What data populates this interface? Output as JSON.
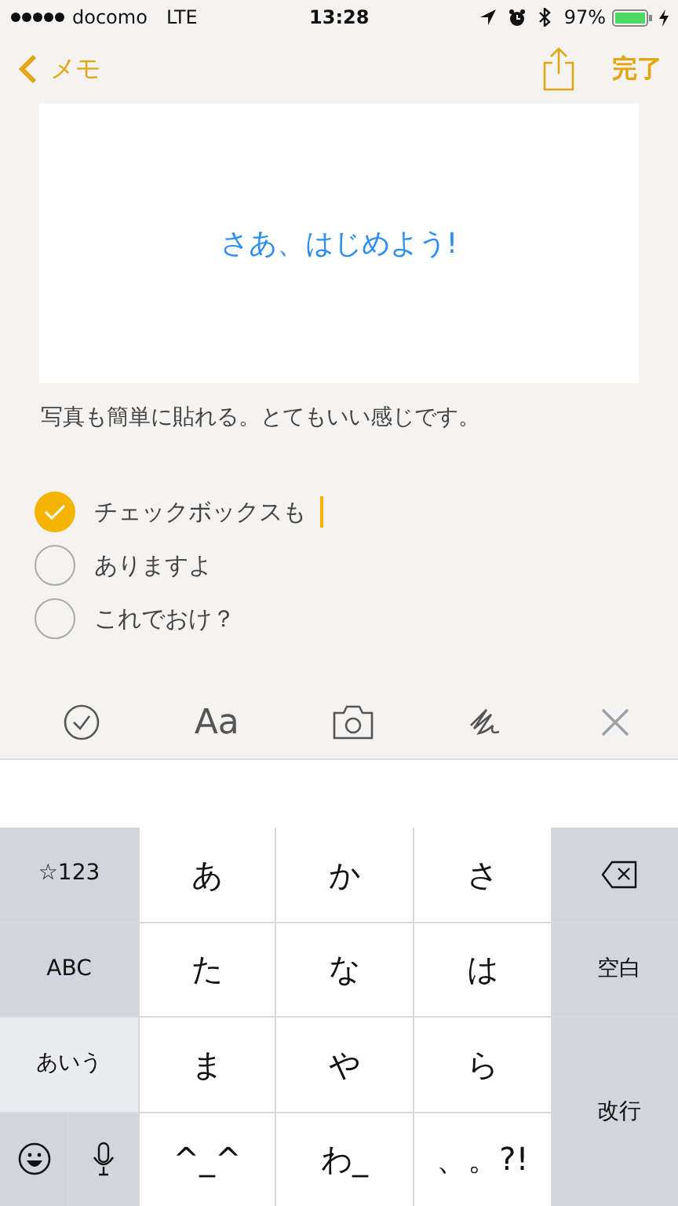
{
  "status_bar": {
    "carrier": "docomo",
    "network": "LTE",
    "time": "13:28",
    "battery": "97%"
  },
  "nav": {
    "back": "メモ",
    "done": "完了"
  },
  "note": {
    "image_text": "さあ、はじめよう!",
    "paragraph": "写真も簡単に貼れる。とてもいい感じです。",
    "checklist": [
      {
        "text": "チェックボックスも",
        "checked": true,
        "cursor": true
      },
      {
        "text": "ありますよ",
        "checked": false,
        "cursor": false
      },
      {
        "text": "これでおけ？",
        "checked": false,
        "cursor": false
      }
    ]
  },
  "toolbar": {
    "format": "Aa"
  },
  "keyboard": {
    "keys": [
      {
        "label": "☆123",
        "kind": "mode",
        "selected": false
      },
      {
        "label": "あ",
        "kind": "letter"
      },
      {
        "label": "か",
        "kind": "letter"
      },
      {
        "label": "さ",
        "kind": "letter"
      },
      {
        "kind": "delete"
      },
      {
        "label": "ABC",
        "kind": "mode",
        "selected": false
      },
      {
        "label": "た",
        "kind": "letter"
      },
      {
        "label": "な",
        "kind": "letter"
      },
      {
        "label": "は",
        "kind": "letter"
      },
      {
        "label": "空白",
        "kind": "function"
      },
      {
        "label": "あいう",
        "kind": "mode",
        "selected": true
      },
      {
        "label": "ま",
        "kind": "letter"
      },
      {
        "label": "や",
        "kind": "letter"
      },
      {
        "label": "ら",
        "kind": "letter"
      },
      {
        "label": "改行",
        "kind": "return"
      },
      {
        "kind": "emoji"
      },
      {
        "kind": "mic"
      },
      {
        "label": "^_^",
        "kind": "letter"
      },
      {
        "label": "わ_",
        "kind": "letter"
      },
      {
        "label": "、。?!",
        "kind": "letter"
      }
    ]
  }
}
